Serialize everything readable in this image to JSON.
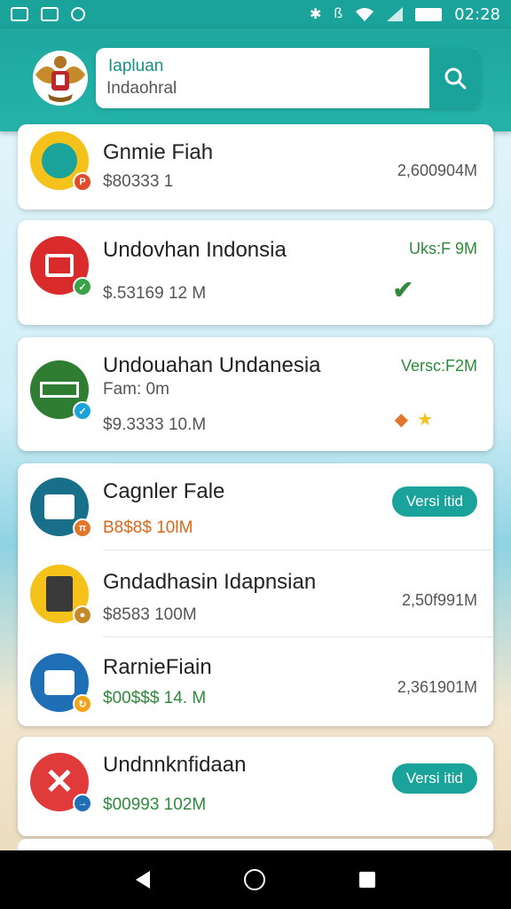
{
  "status_bar": {
    "time": "02:28",
    "icons": [
      "notification-icon",
      "image-icon",
      "circle-app-icon",
      "bluetooth-icon",
      "vibrate-icon",
      "wifi-icon",
      "signal-icon",
      "battery-icon"
    ]
  },
  "header": {
    "search_title": "Iapluan",
    "search_value": "Indaohral",
    "search_icon": "search-icon",
    "logo": "garuda-emblem-logo",
    "accent": "#1aa39a"
  },
  "apps": [
    {
      "name": "Gnmie Fiah",
      "price": "$80333 1",
      "right": "2,600904M",
      "icon_color": "#f4c21a",
      "badge_color": "#e04b2a"
    },
    {
      "name": "Undovhan  Indonsia",
      "price": "$.53169 12 M",
      "right": "Uks:F 9M",
      "icon_color": "#d92b2b",
      "badge_color": "#3aa34a"
    },
    {
      "name": "Undouahan Undanesia",
      "sub": "Fam: 0m",
      "price": "$9.3333 10.M",
      "right": "Versc:F2M",
      "icon_color": "#2e7d32",
      "badge_color": "#1aa3d9"
    },
    {
      "name": "Cagnler Fale",
      "price": "B8$8$ 10lM",
      "right": "Versi itid",
      "icon_color": "#176f8a",
      "badge_color": "#e2762a"
    },
    {
      "name": "Gndadhasin Idapnsian",
      "price": "$8583 100M",
      "right": "2,50f991M",
      "icon_color": "#f4c21a",
      "badge_color": "#c58a2a"
    },
    {
      "name": "RarnieFiain",
      "price": "$00$$$ 14. M",
      "right": "2,361901M",
      "icon_color": "#1e6fb5",
      "badge_color": "#f4a21a"
    },
    {
      "name": "Undnnknfidaan",
      "price": "$00993 102M",
      "right": "Versi itid",
      "icon_color": "#e03a3a",
      "badge_color": "#1e6fb5"
    }
  ],
  "nav": {
    "back": "back-icon",
    "home": "home-icon",
    "recents": "recents-icon"
  }
}
